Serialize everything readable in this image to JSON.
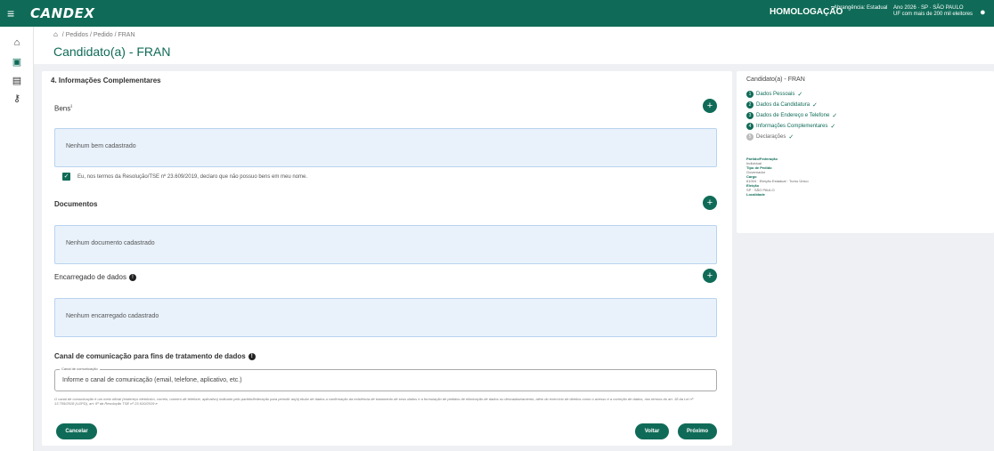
{
  "topbar": {
    "menu_icon": "menu-icon",
    "logo": "CANDEX",
    "environment": "HOMOLOGAÇÃO",
    "context_left": [
      "Abrangência: Estadual"
    ],
    "context_right": [
      "Ano 2026 · SP · SÃO PAULO",
      "UF com mais de 200 mil eleitores"
    ],
    "user_icon": "user-icon"
  },
  "siderail": {
    "icons": [
      "home-icon",
      "briefcase-icon",
      "printer-icon",
      "key-icon"
    ]
  },
  "breadcrumb": [
    "Pedidos",
    "Pedido",
    "FRAN"
  ],
  "page_title": "Candidato(a) - FRAN",
  "form": {
    "section_title": "4. Informações Complementares",
    "bens": {
      "title": "Bens",
      "empty_text": "Nenhum bem cadastrado",
      "declaration": "Eu, nos termos da Resolução/TSE nº 23.609/2019, declaro que não possuo bens em meu nome."
    },
    "documentos": {
      "title": "Documentos",
      "empty_text": "Nenhum documento cadastrado"
    },
    "encarregado": {
      "title": "Encarregado de dados",
      "empty_text": "Nenhum encarregado cadastrado"
    },
    "canal": {
      "title": "Canal de comunicação para fins de tratamento de dados",
      "legend": "Canal de comunicação",
      "placeholder": "Informe o canal de comunicação (email, telefone, aplicativo, etc.)",
      "help": "O canal de comunicação é um meio oficial (endereço eletrônico, correio, número de telefone, aplicativo) indicado pelo partido/federação para permitir ao(à) titular de dados a confirmação da existência de tratamento de seus dados e a formulação de pedidos de eliminação de dados ou descadastramento, além do exercício de direitos como o acesso e a correção de dados, nos termos do art. 18 da Lei nº 13.709/2018 (LGPD), art. 6º da Resolução TSE nº 23.610/2019 e"
    },
    "buttons": {
      "cancel": "Cancelar",
      "back": "Voltar",
      "next": "Próximo"
    }
  },
  "progress": {
    "title": "Candidato(a) - FRAN",
    "steps": [
      {
        "n": "1",
        "label": "Dados Pessoais",
        "done": true
      },
      {
        "n": "2",
        "label": "Dados da Candidatura",
        "done": true
      },
      {
        "n": "3",
        "label": "Dados de Endereço e Telefone",
        "done": true
      },
      {
        "n": "4",
        "label": "Informações Complementares",
        "done": true
      },
      {
        "n": "5",
        "label": "Declarações",
        "done": false
      }
    ],
    "summary": [
      {
        "label": "Partido/Federação",
        "value": "Individual"
      },
      {
        "label": "Tipo de Pedido",
        "value": "Governador"
      },
      {
        "label": "Cargo",
        "value": "61004 · Eleição Estadual · Turno Único"
      },
      {
        "label": "Eleição",
        "value": "SP · SÃO PAULO"
      },
      {
        "label": "Localidade",
        "value": ""
      }
    ]
  }
}
